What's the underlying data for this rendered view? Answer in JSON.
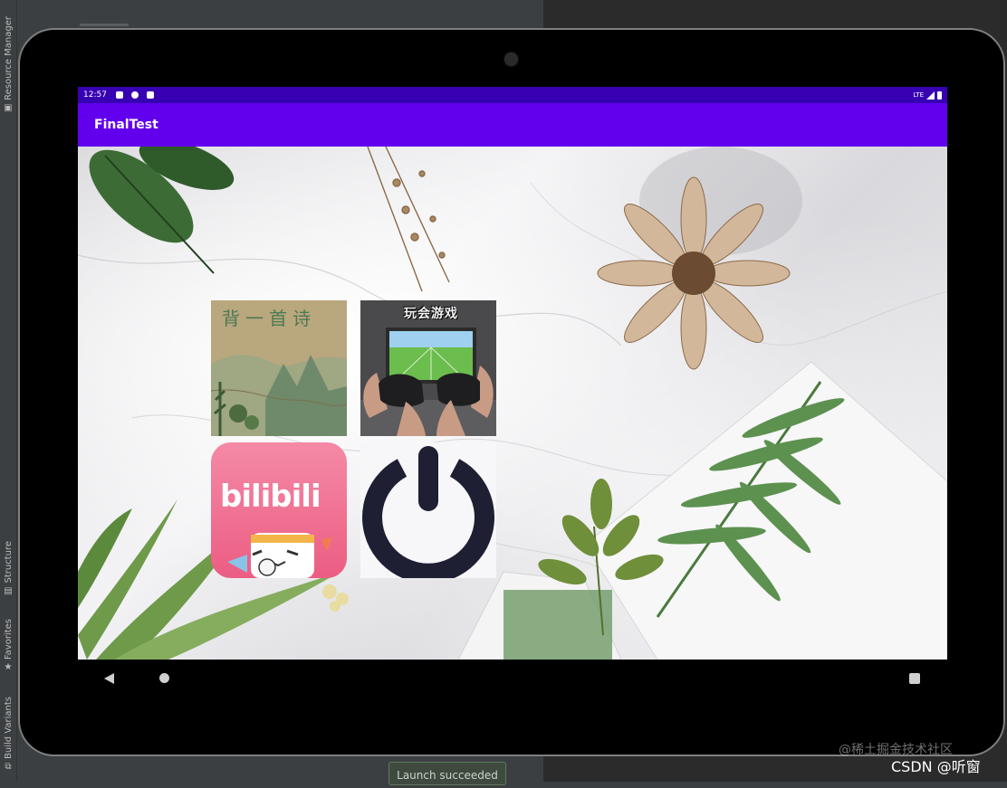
{
  "ide": {
    "tool_windows": [
      "Resource Manager",
      "Structure",
      "Favorites",
      "Build Variants"
    ],
    "toast": "Launch succeeded"
  },
  "device": {
    "status_bar": {
      "time": "12:57",
      "network": "LTE"
    },
    "app_bar": {
      "title": "FinalTest"
    },
    "tiles": [
      {
        "name": "poem",
        "text": "背一首诗"
      },
      {
        "name": "game",
        "text": "玩会游戏"
      },
      {
        "name": "bilibili",
        "text": "bilibili"
      },
      {
        "name": "power",
        "text": ""
      }
    ],
    "nav": [
      "back",
      "home",
      "recents"
    ]
  },
  "watermark": {
    "line1": "@稀土掘金技术社区",
    "line2": "CSDN @听窗"
  },
  "colors": {
    "status_bar": "#3700b3",
    "app_bar": "#6200ee",
    "bilibili_pink": "#f06f8f",
    "power_icon": "#1e1f33"
  }
}
